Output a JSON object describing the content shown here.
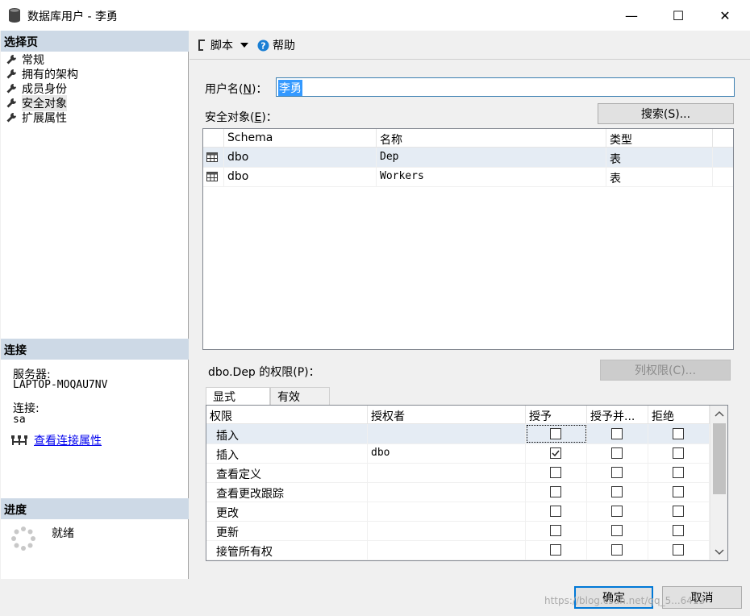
{
  "window": {
    "title": "数据库用户 - 李勇",
    "minimize_glyph": "—",
    "maximize_glyph": "☐",
    "close_glyph": "✕"
  },
  "left": {
    "select_page_header": "选择页",
    "nav_items": [
      {
        "label": "常规",
        "icon": "wrench-icon"
      },
      {
        "label": "拥有的架构",
        "icon": "wrench-icon"
      },
      {
        "label": "成员身份",
        "icon": "wrench-icon"
      },
      {
        "label": "安全对象",
        "icon": "wrench-icon",
        "selected": true
      },
      {
        "label": "扩展属性",
        "icon": "wrench-icon"
      }
    ],
    "connection_header": "连接",
    "server_label": "服务器:",
    "server_value": "LAPTOP-MOQAU7NV",
    "connection_label": "连接:",
    "connection_value": "sa",
    "view_conn_props_link": "查看连接属性",
    "progress_header": "进度",
    "progress_status": "就绪"
  },
  "toolbar": {
    "script_label": "脚本",
    "help_label": "帮助"
  },
  "form": {
    "username_label_pre": "用户名(",
    "username_label_key": "N",
    "username_label_post": ")：",
    "username_value": "李勇",
    "securables_label_pre": "安全对象(",
    "securables_label_key": "E",
    "securables_label_post": ")：",
    "search_button": "搜索(S)...",
    "perm_label": "dbo.Dep 的权限(P)：",
    "col_perm_button": "列权限(C)...",
    "ok_button": "确定",
    "cancel_button": "取消"
  },
  "securables": {
    "columns": [
      "Schema",
      "名称",
      "类型"
    ],
    "rows": [
      {
        "schema": "dbo",
        "name": "Dep",
        "type": "表",
        "selected": true
      },
      {
        "schema": "dbo",
        "name": "Workers",
        "type": "表",
        "selected": false
      }
    ]
  },
  "perm_tabs": [
    {
      "label": "显式",
      "active": true
    },
    {
      "label": "有效",
      "active": false
    }
  ],
  "permissions": {
    "columns": [
      "权限",
      "授权者",
      "授予",
      "授予并...",
      "拒绝"
    ],
    "rows": [
      {
        "permission": "插入",
        "grantor": "",
        "grant": false,
        "with_grant": false,
        "deny": false
      },
      {
        "permission": "插入",
        "grantor": "dbo",
        "grant": true,
        "with_grant": false,
        "deny": false
      },
      {
        "permission": "查看定义",
        "grantor": "",
        "grant": false,
        "with_grant": false,
        "deny": false
      },
      {
        "permission": "查看更改跟踪",
        "grantor": "",
        "grant": false,
        "with_grant": false,
        "deny": false
      },
      {
        "permission": "更改",
        "grantor": "",
        "grant": false,
        "with_grant": false,
        "deny": false
      },
      {
        "permission": "更新",
        "grantor": "",
        "grant": false,
        "with_grant": false,
        "deny": false
      },
      {
        "permission": "接管所有权",
        "grantor": "",
        "grant": false,
        "with_grant": false,
        "deny": false
      }
    ]
  },
  "watermark": "https://blog.csdn.net/qq_5...6413",
  "colors": {
    "section_header": "#cdd9e6",
    "selected_row": "#e5ecf4",
    "selection_highlight": "#3399ff",
    "link": "#0000ee"
  }
}
